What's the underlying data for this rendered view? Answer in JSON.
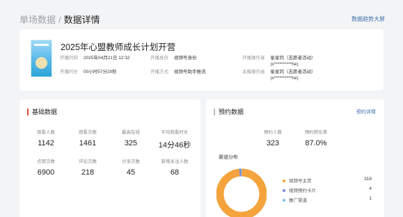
{
  "breadcrumb": {
    "parent": "单场数据",
    "separator": "/",
    "current": "数据详情"
  },
  "header": {
    "big_screen_link": "数据趋势大屏"
  },
  "live": {
    "title": "2025年心盟教师成长计划开营",
    "start_time_label": "开播时间",
    "start_time": "2025年04月21日 12:32",
    "duration_label": "开播时长",
    "duration": "00小时57分20秒",
    "identity_label": "开播身份",
    "identity": "视频号身份",
    "method_label": "开播方式",
    "method": "视频号助手推流",
    "operator_label": "开播操作者",
    "operator_name": "星星同（志愿者活动）",
    "operator_id": "(x**********he)",
    "closer_label": "关播操作者",
    "closer_name": "星星同（志愿者活动）",
    "closer_id": "(x**********he)"
  },
  "basic": {
    "title": "基础数据",
    "stats": [
      {
        "label": "观看人数",
        "value": "1142"
      },
      {
        "label": "观看次数",
        "value": "1461"
      },
      {
        "label": "最高在线",
        "value": "325"
      },
      {
        "label": "平均观看时长",
        "value": "14分46秒"
      },
      {
        "label": "点赞次数",
        "value": "6900"
      },
      {
        "label": "评论次数",
        "value": "218"
      },
      {
        "label": "分享次数",
        "value": "45"
      },
      {
        "label": "新增关注人数",
        "value": "68"
      }
    ]
  },
  "reservation": {
    "title": "预约数据",
    "detail_link": "预约详情",
    "stats": [
      {
        "label": "预约人数",
        "value": "323"
      },
      {
        "label": "预约转化率",
        "value": "87.0%"
      }
    ],
    "channel_title": "渠道分布",
    "channels": [
      {
        "name": "视频号主页",
        "count": "318",
        "color": "#f5a33c"
      },
      {
        "name": "视频预约卡片",
        "count": "4",
        "color": "#7b85d8"
      },
      {
        "name": "推广渠道",
        "count": "1",
        "color": "#78c0e8"
      }
    ]
  },
  "chart_data": {
    "type": "pie",
    "title": "渠道分布",
    "categories": [
      "视频号主页",
      "视频预约卡片",
      "推广渠道"
    ],
    "values": [
      318,
      4,
      1
    ],
    "colors": [
      "#f5a33c",
      "#7b85d8",
      "#78c0e8"
    ]
  }
}
